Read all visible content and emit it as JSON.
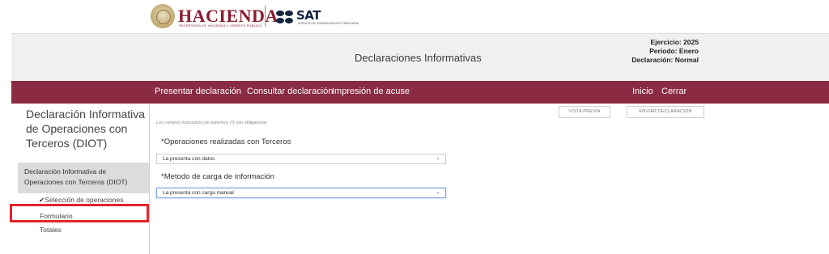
{
  "logos": {
    "hacienda_title": "HACIENDA",
    "hacienda_subtitle": "SECRETARÍA DE HACIENDA Y CRÉDITO PÚBLICO",
    "sat_title": "SAT",
    "sat_subtitle": "SERVICIO DE ADMINISTRACIÓN TRIBUTARIA"
  },
  "header": {
    "title": "Declaraciones Informativas",
    "ejercicio": "Ejercicio: 2025",
    "periodo": "Periodo: Enero",
    "declaracion": "Declaración: Normal"
  },
  "nav": {
    "presentar": "Presentar declaración",
    "consultar": "Consultar declaración",
    "impresion": "Impresión de acuse",
    "inicio": "Inicio",
    "cerrar": "Cerrar"
  },
  "sidebar": {
    "title": "Declaración Informativa de Operaciones con Terceros (DIOT)",
    "active_item": "Declaración Informativa de Operaciones con Terceros (DIOT)",
    "sub_items": [
      "Selección de operaciones",
      "Formulario",
      "Totales"
    ]
  },
  "actions": {
    "preview": "VISTA PREVIA",
    "send": "ENVIAR DECLARACIÓN"
  },
  "form": {
    "required_note": "Los campos marcados con asterisco (*) son obligatorios",
    "field1_label": "*Operaciones realizadas con Terceros",
    "field1_value": "La presenta con datos",
    "field2_label": "*Metodo de carga de información",
    "field2_value": "La presenta con carga manual"
  },
  "colors": {
    "brand_maroon": "#8a2a43",
    "highlight_red": "#e3242b"
  }
}
